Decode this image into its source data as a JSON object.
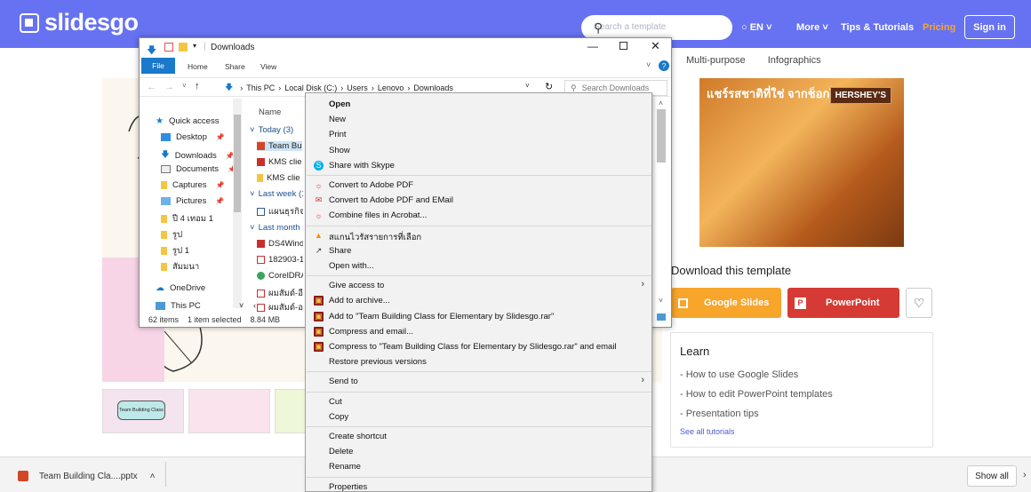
{
  "header": {
    "logo": "slidesgo",
    "search_placeholder": "Search a template",
    "language": "EN",
    "more": "More",
    "tips": "Tips & Tutorials",
    "pricing": "Pricing",
    "sign_in": "Sign in",
    "colors": {
      "bar": "#6672f1",
      "pricing": "#f7a52b"
    }
  },
  "subnav": {
    "multi": "Multi-purpose",
    "info": "Infographics"
  },
  "photo": {
    "brand": "HERSHEY'S",
    "thai": "แชร์รสชาติที่ใช่ จากช็อกโกแลตแท้"
  },
  "download": {
    "title": "Download this template",
    "google": "Google Slides",
    "powerpoint": "PowerPoint",
    "colors": {
      "google": "#f7a52b",
      "powerpoint": "#d63a34"
    }
  },
  "learn": {
    "title": "Learn",
    "links": [
      "- How to use Google Slides",
      "- How to edit PowerPoint templates",
      "- Presentation tips"
    ],
    "see_all": "See all tutorials"
  },
  "thumb": {
    "caption": "Team Building Class"
  },
  "downloads_bar": {
    "file": "Team Building Cla....pptx",
    "show_all": "Show all"
  },
  "explorer": {
    "title": "Downloads",
    "ribbon": [
      "File",
      "Home",
      "Share",
      "View"
    ],
    "path": [
      "This PC",
      "Local Disk (C:)",
      "Users",
      "Lenovo",
      "Downloads"
    ],
    "search_placeholder": "Search Downloads",
    "nav": [
      {
        "label": "Quick access",
        "icon": "star-icon"
      },
      {
        "label": "Desktop",
        "icon": "desktop-icon"
      },
      {
        "label": "Downloads",
        "icon": "download-icon"
      },
      {
        "label": "Documents",
        "icon": "documents-icon"
      },
      {
        "label": "Captures",
        "icon": "folder-icon"
      },
      {
        "label": "Pictures",
        "icon": "pictures-icon"
      },
      {
        "label": "ปี 4 เทอม 1",
        "icon": "folder-icon"
      },
      {
        "label": "รูป",
        "icon": "folder-icon"
      },
      {
        "label": "รูป 1",
        "icon": "folder-icon"
      },
      {
        "label": "สัมมนา",
        "icon": "folder-icon"
      },
      {
        "label": "OneDrive",
        "icon": "cloud-icon"
      },
      {
        "label": "This PC",
        "icon": "pc-icon"
      }
    ],
    "column_name": "Name",
    "groups": {
      "today": "Today (3)",
      "last_week": "Last week (1",
      "last_month": "Last month ("
    },
    "files": [
      "Team Bu",
      "KMS clie",
      "KMS clie",
      "แผนธุรกิจ",
      "DS4Wind",
      "182903-1",
      "CorelDRA",
      "ผมสัมด์-อี",
      "ผมสัมด์-อ"
    ],
    "status": {
      "count": "62 items",
      "selected": "1 item selected",
      "size": "8.84 MB"
    }
  },
  "context_menu": {
    "items": [
      {
        "label": "Open",
        "bold": true
      },
      {
        "label": "New"
      },
      {
        "label": "Print"
      },
      {
        "label": "Show"
      },
      {
        "label": "Share with Skype",
        "icon": "skype-icon"
      },
      {
        "sep": true
      },
      {
        "label": "Convert to Adobe PDF",
        "icon": "acrobat-icon"
      },
      {
        "label": "Convert to Adobe PDF and EMail",
        "icon": "acrobat-mail-icon"
      },
      {
        "label": "Combine files in Acrobat...",
        "icon": "acrobat-combine-icon"
      },
      {
        "sep": true
      },
      {
        "label": "สแกนไวรัสรายการที่เลือก",
        "icon": "antivirus-icon"
      },
      {
        "label": "Share",
        "icon": "share-icon"
      },
      {
        "label": "Open with..."
      },
      {
        "sep": true
      },
      {
        "label": "Give access to",
        "submenu": true
      },
      {
        "label": "Add to archive...",
        "icon": "winrar-icon"
      },
      {
        "label": "Add to \"Team Building Class for Elementary by Slidesgo.rar\"",
        "icon": "winrar-icon"
      },
      {
        "label": "Compress and email...",
        "icon": "winrar-icon"
      },
      {
        "label": "Compress to \"Team Building Class for Elementary by Slidesgo.rar\" and email",
        "icon": "winrar-icon"
      },
      {
        "label": "Restore previous versions"
      },
      {
        "sep": true
      },
      {
        "label": "Send to",
        "submenu": true
      },
      {
        "sep": true
      },
      {
        "label": "Cut"
      },
      {
        "label": "Copy"
      },
      {
        "sep": true
      },
      {
        "label": "Create shortcut"
      },
      {
        "label": "Delete"
      },
      {
        "label": "Rename"
      },
      {
        "sep": true
      },
      {
        "label": "Properties"
      }
    ]
  }
}
